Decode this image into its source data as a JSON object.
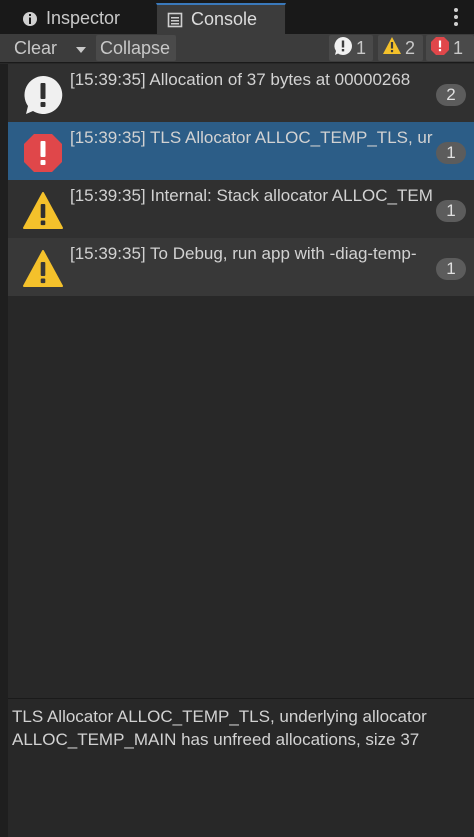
{
  "tabs": [
    {
      "label": "Inspector",
      "icon": "info-icon"
    },
    {
      "label": "Console",
      "icon": "console-icon",
      "active": true
    }
  ],
  "toolbar": {
    "clear_label": "Clear",
    "collapse_label": "Collapse",
    "info_count": "1",
    "warning_count": "2",
    "error_count": "1"
  },
  "logs": [
    {
      "type": "info",
      "text": "[15:39:35] Allocation of 37 bytes at 00000268",
      "count": "2"
    },
    {
      "type": "error",
      "text": "[15:39:35] TLS Allocator ALLOC_TEMP_TLS, ur",
      "count": "1",
      "selected": true
    },
    {
      "type": "warning",
      "text": "[15:39:35] Internal: Stack allocator ALLOC_TEM",
      "count": "1"
    },
    {
      "type": "warning",
      "text": "[15:39:35] To Debug, run app with -diag-temp-",
      "count": "1"
    }
  ],
  "details": {
    "text": "TLS Allocator ALLOC_TEMP_TLS, underlying allocator ALLOC_TEMP_MAIN has unfreed allocations, size 37"
  },
  "colors": {
    "selected_row": "#2c5d87",
    "error_red": "#e0474a",
    "warning_yellow": "#f4c12b",
    "info_white": "#f0f0f0",
    "active_tab_accent": "#3a79bb"
  }
}
